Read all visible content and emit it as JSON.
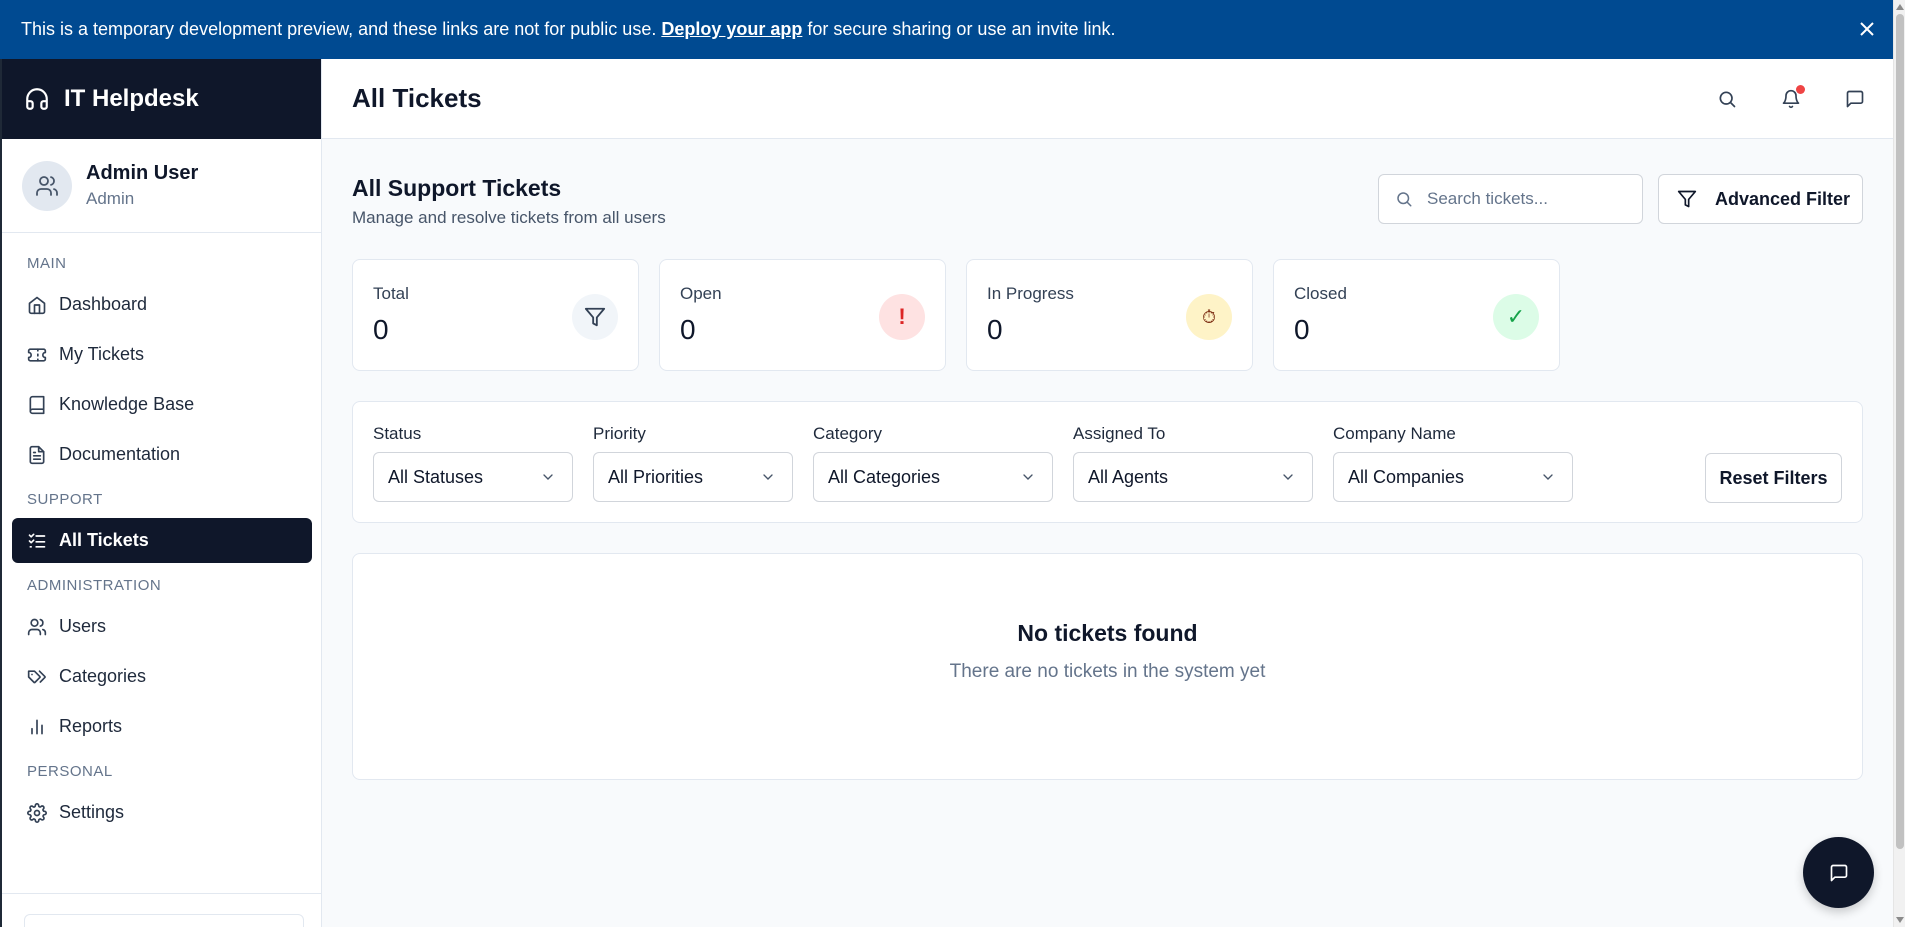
{
  "banner": {
    "text_before": "This is a temporary development preview, and these links are not for public use.",
    "link": "Deploy your app",
    "text_after": "for secure sharing or use an invite link.",
    "close_icon": "close-icon"
  },
  "app": {
    "title": "IT Helpdesk",
    "logo_icon": "headset-icon"
  },
  "user": {
    "name": "Admin User",
    "role": "Admin"
  },
  "sidebar": {
    "sections": [
      {
        "title": "MAIN",
        "items": [
          {
            "label": "Dashboard",
            "icon": "home-icon"
          },
          {
            "label": "My Tickets",
            "icon": "ticket-icon"
          },
          {
            "label": "Knowledge Base",
            "icon": "book-icon"
          },
          {
            "label": "Documentation",
            "icon": "document-icon"
          }
        ]
      },
      {
        "title": "SUPPORT",
        "items": [
          {
            "label": "All Tickets",
            "icon": "list-check-icon",
            "active": true
          }
        ]
      },
      {
        "title": "ADMINISTRATION",
        "items": [
          {
            "label": "Users",
            "icon": "users-icon"
          },
          {
            "label": "Categories",
            "icon": "tags-icon"
          },
          {
            "label": "Reports",
            "icon": "bar-chart-icon"
          }
        ]
      },
      {
        "title": "PERSONAL",
        "items": [
          {
            "label": "Settings",
            "icon": "gear-icon"
          }
        ]
      }
    ]
  },
  "header": {
    "title": "All Tickets"
  },
  "main": {
    "title": "All Support Tickets",
    "subtitle": "Manage and resolve tickets from all users",
    "search_placeholder": "Search tickets...",
    "advanced_filter_label": "Advanced Filter"
  },
  "stats": [
    {
      "label": "Total",
      "value": "0",
      "icon": "filter-icon",
      "color": "#f1f5f9"
    },
    {
      "label": "Open",
      "value": "0",
      "icon": "exclamation-icon",
      "color": "#fee2e2",
      "glyph": "!"
    },
    {
      "label": "In Progress",
      "value": "0",
      "icon": "stopwatch-icon",
      "color": "#fef3c7",
      "glyph": "⏱"
    },
    {
      "label": "Closed",
      "value": "0",
      "icon": "check-icon",
      "color": "#dcfce7",
      "glyph": "✓"
    }
  ],
  "filters": {
    "status": {
      "label": "Status",
      "value": "All Statuses"
    },
    "priority": {
      "label": "Priority",
      "value": "All Priorities"
    },
    "category": {
      "label": "Category",
      "value": "All Categories"
    },
    "assigned": {
      "label": "Assigned To",
      "value": "All Agents"
    },
    "company": {
      "label": "Company Name",
      "value": "All Companies"
    },
    "reset_label": "Reset Filters"
  },
  "empty": {
    "title": "No tickets found",
    "subtitle": "There are no tickets in the system yet"
  },
  "colors": {
    "primary": "#0f172a",
    "banner": "#004a91",
    "notification": "#ef4444"
  }
}
